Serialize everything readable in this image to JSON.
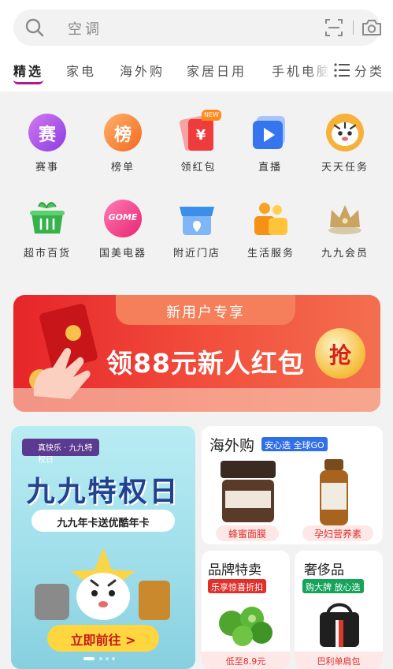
{
  "search": {
    "placeholder": "空调"
  },
  "tabs": [
    {
      "label": "精选",
      "active": true
    },
    {
      "label": "家电"
    },
    {
      "label": "海外购"
    },
    {
      "label": "家居日用"
    },
    {
      "label": "手机电脑"
    }
  ],
  "category_label": "分类",
  "shortcuts": [
    {
      "label": "赛事",
      "icon": "match-icon",
      "glyph": "赛"
    },
    {
      "label": "榜单",
      "icon": "ranking-icon",
      "glyph": "榜"
    },
    {
      "label": "领红包",
      "icon": "red-packet-icon",
      "badge": "NEW"
    },
    {
      "label": "直播",
      "icon": "live-play-icon"
    },
    {
      "label": "天天任务",
      "icon": "tiger-icon"
    },
    {
      "label": "超市百货",
      "icon": "basket-icon"
    },
    {
      "label": "国美电器",
      "icon": "gome-logo-icon",
      "glyph": "GOME"
    },
    {
      "label": "附近门店",
      "icon": "store-icon"
    },
    {
      "label": "生活服务",
      "icon": "people-icon"
    },
    {
      "label": "九九会员",
      "icon": "crown-icon"
    }
  ],
  "banner": {
    "header": "新用户专享",
    "main": "领88元新人红包",
    "button": "抢"
  },
  "promo": {
    "tag": "真快乐 · 九九特权日",
    "title": "九九特权日",
    "subtitle": "九九年卡送优酷年卡",
    "button": "立即前往 >"
  },
  "overseas": {
    "title": "海外购",
    "badge": "安心选 全球GO",
    "items": [
      {
        "label": "蜂蜜面膜"
      },
      {
        "label": "孕妇营养素"
      }
    ]
  },
  "brand_sale": {
    "title": "品牌特卖",
    "badge": "乐享惊喜折扣",
    "price": "低至8.9元"
  },
  "luxury": {
    "title": "奢侈品",
    "badge": "购大牌 放心选",
    "caption": "巴利单肩包"
  },
  "colors": {
    "accent": "#b5178c",
    "red": "#e6252a",
    "blue_badge": "#2f6fe8",
    "green_badge": "#16a35a"
  }
}
